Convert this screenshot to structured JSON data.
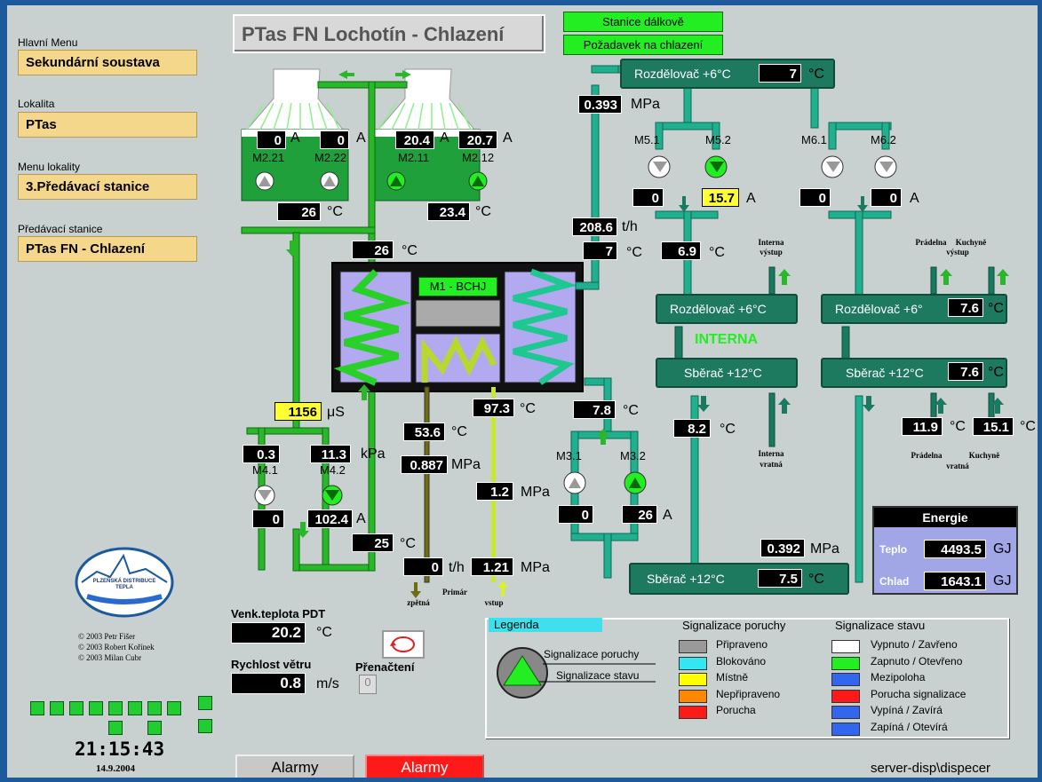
{
  "title": "PTas FN Lochotín - Chlazení",
  "status_buttons": {
    "remote": "Stanice dálkově",
    "request": "Požadavek na chlazení"
  },
  "sidebar": {
    "main_menu_label": "Hlavní Menu",
    "main_menu_value": "Sekundární soustava",
    "location_label": "Lokalita",
    "location_value": "PTas",
    "location_menu_label": "Menu lokality",
    "location_menu_value": "3.Předávací stanice",
    "station_label": "Předávací stanice",
    "station_value": "PTas FN - Chlazení"
  },
  "copyright": [
    "© 2003 Petr Fišer",
    "© 2003 Robert Kořínek",
    "© 2003 Milan Cubr"
  ],
  "logo": {
    "line1": "PLZEŇSKÁ DISTRIBUCE",
    "line2": "TEPLA"
  },
  "clock": {
    "time": "21:15:43",
    "date": "14.9.2004"
  },
  "outside": {
    "temp_label": "Venk.teplota PDT",
    "temp_value": "20.2",
    "temp_unit": "°C",
    "wind_label": "Rychlost větru",
    "wind_value": "0.8",
    "wind_unit": "m/s",
    "reload_label": "Přenačtení",
    "reload_value": "0"
  },
  "buttons": {
    "alarms_gray": "Alarmy",
    "alarms_red": "Alarmy"
  },
  "server": "server-disp\\dispecer",
  "fans": {
    "left": {
      "m221": "M2.21",
      "m222": "M2.22",
      "a1": "0",
      "a2": "0",
      "amp": "A",
      "temp": "26",
      "temp_unit": "°C"
    },
    "right": {
      "m211": "M2.11",
      "m212": "M2.12",
      "a1": "20.4",
      "a2": "20.7",
      "amp": "A",
      "temp": "23.4",
      "temp_unit": "°C"
    }
  },
  "chiller": {
    "label": "M1 - BCHJ",
    "in_temp": "26",
    "in_unit": "°C"
  },
  "m4": {
    "p1": "0.3",
    "p2": "11.3",
    "p_unit": "kPa",
    "m41": "M4.1",
    "m42": "M4.2",
    "a1": "0",
    "a2": "102.4",
    "amp": "A",
    "conductivity": "1156",
    "cond_unit": "μS",
    "temp": "25",
    "temp_unit": "°C"
  },
  "primary": {
    "t1": "53.6",
    "t1u": "°C",
    "p1": "0.887",
    "p1u": "MPa",
    "t2": "97.3",
    "t2u": "°C",
    "p2": "1.2",
    "p2u": "MPa",
    "flow": "0",
    "flow_u": "t/h",
    "p3": "1.21",
    "p3u": "MPa",
    "ret": "zpětná",
    "lbl": "Primár",
    "sup": "vstup"
  },
  "main": {
    "p": "0.393",
    "p_u": "MPa",
    "flow": "208.6",
    "flow_u": "t/h",
    "t": "7",
    "t_u": "°C"
  },
  "rozdelovac_top": {
    "label": "Rozdělovač +6°C",
    "value": "7",
    "unit": "°C"
  },
  "m5": {
    "m51": "M5.1",
    "m52": "M5.2",
    "a1": "0",
    "a2": "15.7",
    "amp": "A",
    "t": "6.9",
    "t_u": "°C"
  },
  "m6": {
    "m61": "M6.1",
    "m62": "M6.2",
    "a1": "0",
    "a2": "0",
    "amp": "A"
  },
  "interna": {
    "label": "INTERNA",
    "rozdel": "Rozdělovač +6°C",
    "sberac": "Sběrač +12°C",
    "out_l1": "Interna",
    "out_l2": "výstup",
    "ret_l1": "Interna",
    "ret_l2": "vratná",
    "t": "8.2",
    "t_u": "°C"
  },
  "right_loop": {
    "rozdel": "Rozdělovač +6°",
    "rozdel_v": "7.6",
    "rozdel_u": "°C",
    "sberac": "Sběrač +12°C",
    "sberac_v": "7.6",
    "sberac_u": "°C",
    "prad_out1": "Prádelna",
    "prad_out2": "výstup",
    "kuch_out": "Kuchyně",
    "t1": "11.9",
    "t1u": "°C",
    "t2": "15.1",
    "t2u": "°C",
    "prad_ret1": "Prádelna",
    "prad_ret2": "vratná",
    "kuch_ret1": "Kuchyně",
    "kuch_ret2": "vratná"
  },
  "m3": {
    "m31": "M3.1",
    "m32": "M3.2",
    "a1": "0",
    "a2": "26",
    "amp": "A",
    "t": "7.8",
    "t_u": "°C"
  },
  "sberac_bottom": {
    "label": "Sběrač +12°C",
    "value": "7.5",
    "unit": "°C",
    "p": "0.392",
    "p_u": "MPa"
  },
  "energy": {
    "title": "Energie",
    "heat_label": "Teplo",
    "heat_value": "4493.5",
    "heat_unit": "GJ",
    "cold_label": "Chlad",
    "cold_value": "1643.1",
    "cold_unit": "GJ"
  },
  "legend": {
    "title": "Legenda",
    "fault_link": "Signalizace poruchy",
    "state_link": "Signalizace stavu",
    "fault_header": "Signalizace poruchy",
    "state_header": "Signalizace stavu",
    "fault_items": [
      {
        "label": "Připraveno",
        "color": "#999999"
      },
      {
        "label": "Blokováno",
        "color": "#33e6f0"
      },
      {
        "label": "Místně",
        "color": "#ffff00"
      },
      {
        "label": "Nepřipraveno",
        "color": "#ff8800"
      },
      {
        "label": "Porucha",
        "color": "#ff1a1a"
      }
    ],
    "state_items": [
      {
        "label": "Vypnuto / Zavřeno",
        "color": "#ffffff"
      },
      {
        "label": "Zapnuto / Otevřeno",
        "color": "#22ee22"
      },
      {
        "label": "Mezipoloha",
        "color": "#3366ee"
      },
      {
        "label": "Porucha signalizace",
        "color": "#ff1a1a"
      },
      {
        "label": "Vypíná / Zavírá",
        "color": "#3366ee"
      },
      {
        "label": "Zapíná / Otevírá",
        "color": "#3366ee"
      }
    ]
  },
  "colors": {
    "pipe_cool": "#20b090",
    "pipe_green": "#2aa02a",
    "panel": "#c8d0d0"
  }
}
